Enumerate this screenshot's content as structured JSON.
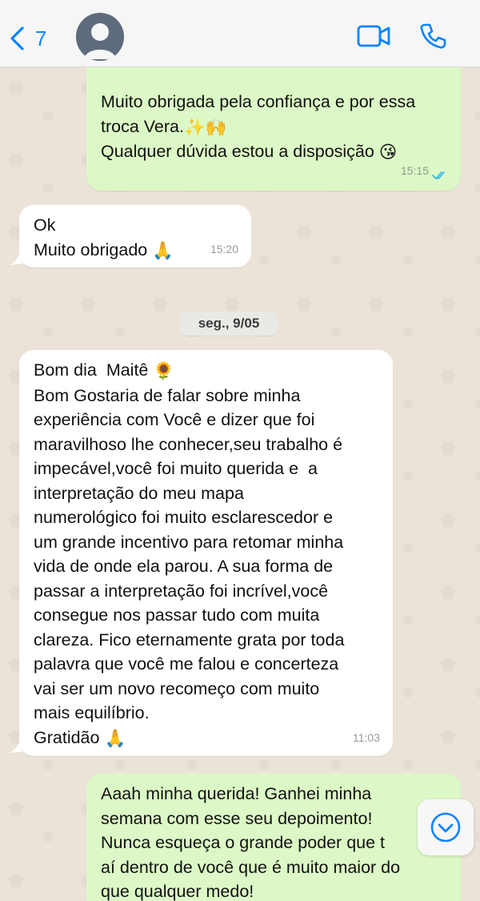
{
  "header": {
    "back_count": "7",
    "icons": [
      "chevron-left-icon",
      "avatar-placeholder-icon",
      "video-camera-icon",
      "phone-icon"
    ],
    "accent_color": "#0a84ff"
  },
  "messages": [
    {
      "direction": "outgoing",
      "lines": [
        "Muito obrigada pela confiança e por essa",
        "troca Vera.",
        "Qualquer dúvida estou a disposição"
      ],
      "emojis": [
        "✨",
        "🙌",
        "😘"
      ],
      "time": "15:15",
      "status": "read"
    },
    {
      "direction": "incoming",
      "lines": [
        "Ok",
        "Muito obrigado"
      ],
      "emojis": [
        "🙏"
      ],
      "time": "15:20"
    },
    {
      "direction": "incoming",
      "lines": [
        "Bom dia  Maitê",
        "Bom Gostaria de falar sobre minha",
        "experiência com Você e dizer que foi",
        "maravilhoso lhe conhecer,seu trabalho é",
        "impecável,você foi muito querida e  a",
        "interpretação do meu mapa",
        "numerológico foi muito esclarescedor e",
        "um grande incentivo para retomar minha",
        "vida de onde ela parou. A sua forma de",
        "passar a interpretação foi incrível,você",
        "consegue nos passar tudo com muita",
        "clareza. Fico eternamente grata por toda",
        "palavra que você me falou e concerteza",
        "vai ser um novo recomeço com muito",
        "mais equilíbrio.",
        "Gratidão"
      ],
      "emojis": [
        "🌻",
        "🙏"
      ],
      "time": "11:03"
    },
    {
      "direction": "outgoing",
      "lines": [
        "Aaah minha querida! Ganhei minha",
        "semana com esse seu depoimento!",
        "Nunca esqueça o grande poder que t",
        "aí dentro de você que é muito maior do",
        "que qualquer medo!"
      ]
    }
  ],
  "date_separator": "seg., 9/05",
  "colors": {
    "outgoing_bubble": "#dcf8c6",
    "incoming_bubble": "#ffffff",
    "read_ticks": "#34b7f1"
  }
}
